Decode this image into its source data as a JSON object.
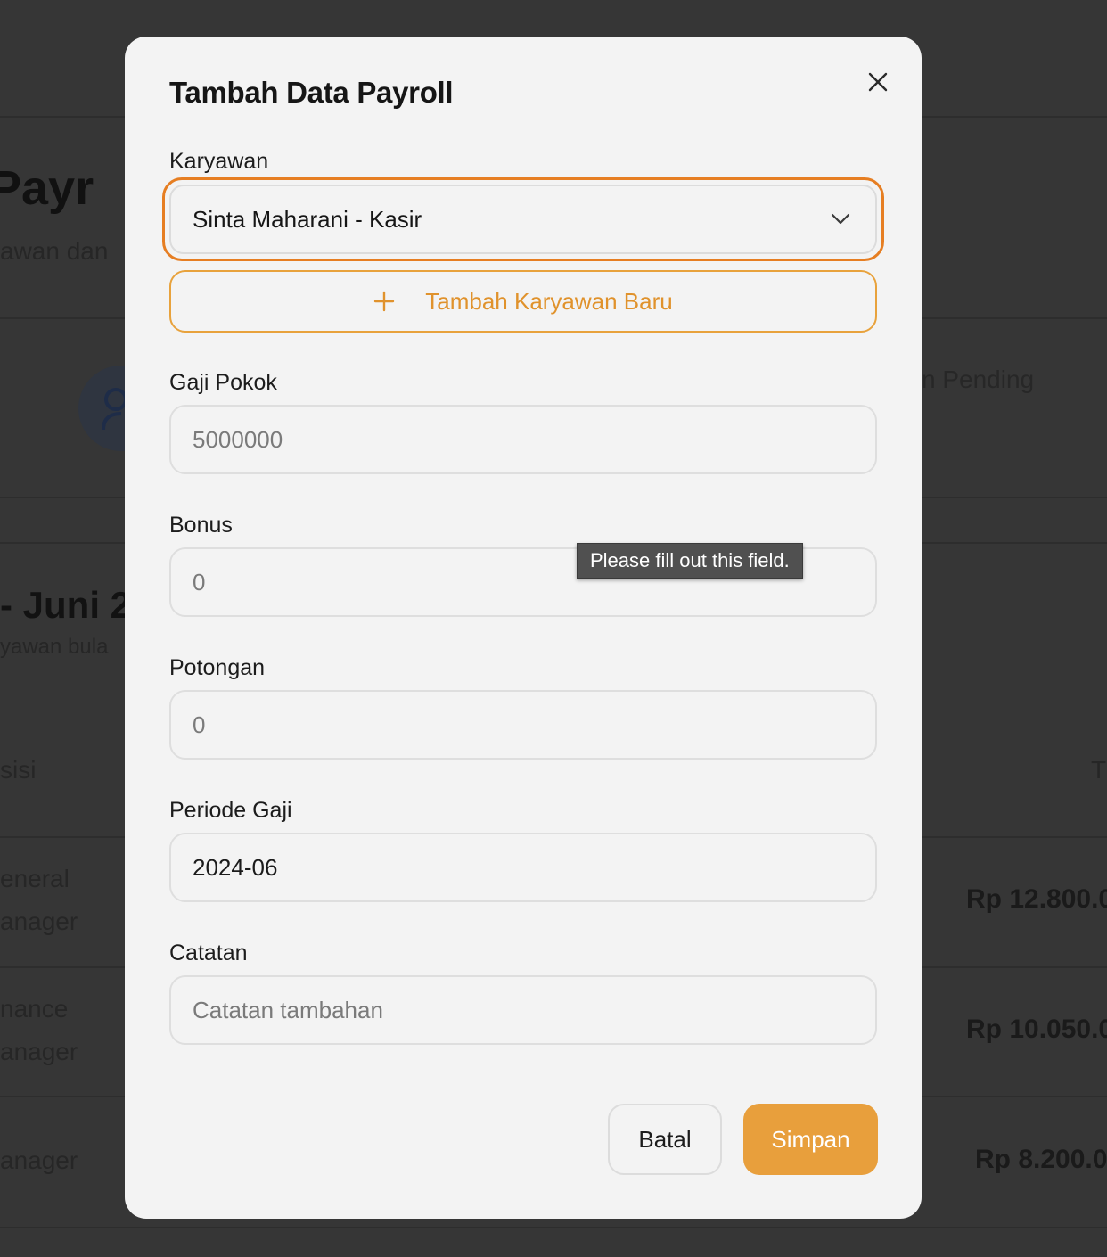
{
  "background": {
    "title_fragment": "Payr",
    "subtitle_fragment": "awan dan",
    "stat_label_fragment": "n Pending",
    "period_title_fragment": "- Juni 2",
    "period_sub_fragment": "yawan bula",
    "column_fragment": "sisi",
    "column_right_fragment": "T",
    "rows": [
      {
        "position_line1": "eneral",
        "position_line2": "anager",
        "amount": "Rp 12.800.0"
      },
      {
        "position_line1": "nance",
        "position_line2": "anager",
        "amount": "Rp 10.050.0"
      },
      {
        "position_line1": "anager",
        "position_line2": "",
        "amount": "Rp 8.200.0"
      }
    ]
  },
  "modal": {
    "title": "Tambah Data Payroll",
    "close_icon": "close-icon",
    "fields": {
      "employee": {
        "label": "Karyawan",
        "value": "Sinta Maharani - Kasir",
        "icon": "chevron-down-icon"
      },
      "add_employee": {
        "label": "Tambah Karyawan Baru",
        "icon": "plus-icon"
      },
      "base_salary": {
        "label": "Gaji Pokok",
        "placeholder": "5000000"
      },
      "bonus": {
        "label": "Bonus",
        "placeholder": "0"
      },
      "deduction": {
        "label": "Potongan",
        "placeholder": "0"
      },
      "period": {
        "label": "Periode Gaji",
        "value": "2024-06"
      },
      "notes": {
        "label": "Catatan",
        "placeholder": "Catatan tambahan"
      }
    },
    "validation_tooltip": "Please fill out this field.",
    "buttons": {
      "cancel": "Batal",
      "save": "Simpan"
    }
  },
  "colors": {
    "accent": "#e89f3c",
    "focus_ring": "#e67e22",
    "modal_bg": "#f3f3f3",
    "overlay": "#363636"
  }
}
